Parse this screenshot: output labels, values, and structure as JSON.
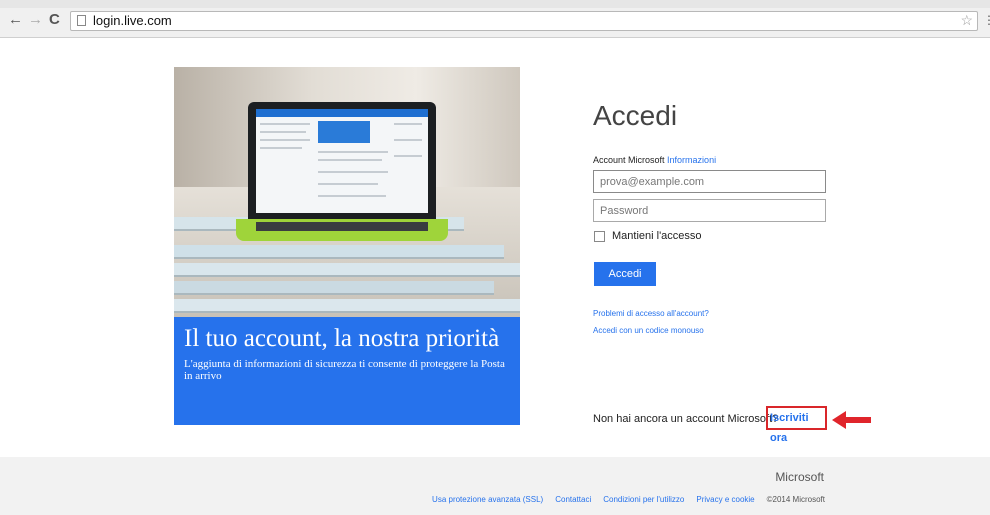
{
  "browser": {
    "url": "login.live.com",
    "back_icon": "←",
    "forward_icon": "→",
    "reload_icon": "C",
    "bookmark_icon": "☆",
    "menu_icon": "⋮"
  },
  "hero": {
    "title": "Il tuo account, la nostra priorità",
    "subtitle": "L'aggiunta di informazioni di sicurezza ti consente di proteggere la Posta in arrivo",
    "banner_color": "#2672ec"
  },
  "login": {
    "title": "Accedi",
    "account_label": "Account Microsoft",
    "info_link": "Informazioni",
    "email_placeholder": "prova@example.com",
    "password_placeholder": "Password",
    "keep_signed_in": "Mantieni l'accesso",
    "submit_label": "Accedi",
    "trouble_link": "Problemi di accesso all'account?",
    "code_link": "Accedi con un codice monouso",
    "no_account_text": "Non hai ancora un account Microsoft?",
    "signup_link": "Iscriviti ora"
  },
  "footer": {
    "brand": "Microsoft",
    "links": [
      "Usa protezione avanzata (SSL)",
      "Contattaci",
      "Condizioni per l'utilizzo",
      "Privacy e cookie"
    ],
    "copyright": "©2014 Microsoft"
  },
  "colors": {
    "accent": "#2672ec",
    "highlight": "#d9262a"
  }
}
